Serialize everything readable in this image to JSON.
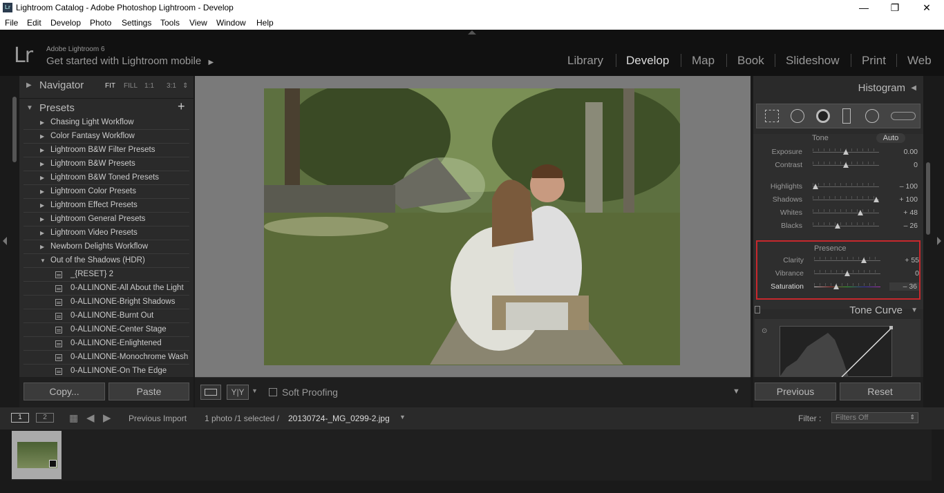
{
  "window": {
    "title": "Lightroom Catalog - Adobe Photoshop Lightroom - Develop",
    "app_icon_text": "Lr",
    "minimize": "—",
    "restore": "❐",
    "close": "✕"
  },
  "menu": [
    "File",
    "Edit",
    "Develop",
    "Photo",
    "Settings",
    "Tools",
    "View",
    "Window",
    "Help"
  ],
  "identity": {
    "logo": "Lr",
    "brand": "Adobe Lightroom 6",
    "mobile": "Get started with Lightroom mobile",
    "modules": [
      "Library",
      "Develop",
      "Map",
      "Book",
      "Slideshow",
      "Print",
      "Web"
    ],
    "active_module": "Develop"
  },
  "left_panel": {
    "navigator": {
      "title": "Navigator",
      "options": [
        "FIT",
        "FILL",
        "1:1",
        "3:1"
      ]
    },
    "presets": {
      "title": "Presets",
      "add": "+",
      "folders": [
        "Chasing Light Workflow",
        "Color Fantasy Workflow",
        "Lightroom B&W Filter Presets",
        "Lightroom B&W Presets",
        "Lightroom B&W Toned Presets",
        "Lightroom Color Presets",
        "Lightroom Effect Presets",
        "Lightroom General Presets",
        "Lightroom Video Presets",
        "Newborn Delights Workflow"
      ],
      "open_folder": "Out of the Shadows (HDR)",
      "items": [
        "_{RESET} 2",
        "0-ALLINONE-All About the Light",
        "0-ALLINONE-Bright Shadows",
        "0-ALLINONE-Burnt Out",
        "0-ALLINONE-Center Stage",
        "0-ALLINONE-Enlightened",
        "0-ALLINONE-Monochrome Wash",
        "0-ALLINONE-On The Edge"
      ]
    },
    "copy_button": "Copy...",
    "paste_button": "Paste"
  },
  "toolbar": {
    "soft_proofing": "Soft Proofing",
    "yy": "Y|Y"
  },
  "right_panel": {
    "histogram": "Histogram",
    "tone": {
      "title": "Tone",
      "auto": "Auto"
    },
    "sliders": [
      {
        "label": "Exposure",
        "value": "0.00",
        "pos": 0.5
      },
      {
        "label": "Contrast",
        "value": "0",
        "pos": 0.5
      },
      {
        "label": "Highlights",
        "value": "– 100",
        "pos": 0.04
      },
      {
        "label": "Shadows",
        "value": "+ 100",
        "pos": 0.96
      },
      {
        "label": "Whites",
        "value": "+ 48",
        "pos": 0.72
      },
      {
        "label": "Blacks",
        "value": "– 26",
        "pos": 0.38
      }
    ],
    "presence": {
      "title": "Presence",
      "sliders": [
        {
          "label": "Clarity",
          "value": "+ 55",
          "pos": 0.75
        },
        {
          "label": "Vibrance",
          "value": "0",
          "pos": 0.5
        },
        {
          "label": "Saturation",
          "value": "– 36",
          "pos": 0.33
        }
      ]
    },
    "tone_curve": "Tone Curve",
    "previous_button": "Previous",
    "reset_button": "Reset",
    "highlight_color": "#c8282d"
  },
  "filmbar": {
    "view1": "1",
    "view2": "2",
    "source": "Previous Import",
    "info": "1 photo /1 selected /",
    "filename": "20130724-_MG_0299-2.jpg",
    "filter_label": "Filter :",
    "filter_value": "Filters Off"
  }
}
